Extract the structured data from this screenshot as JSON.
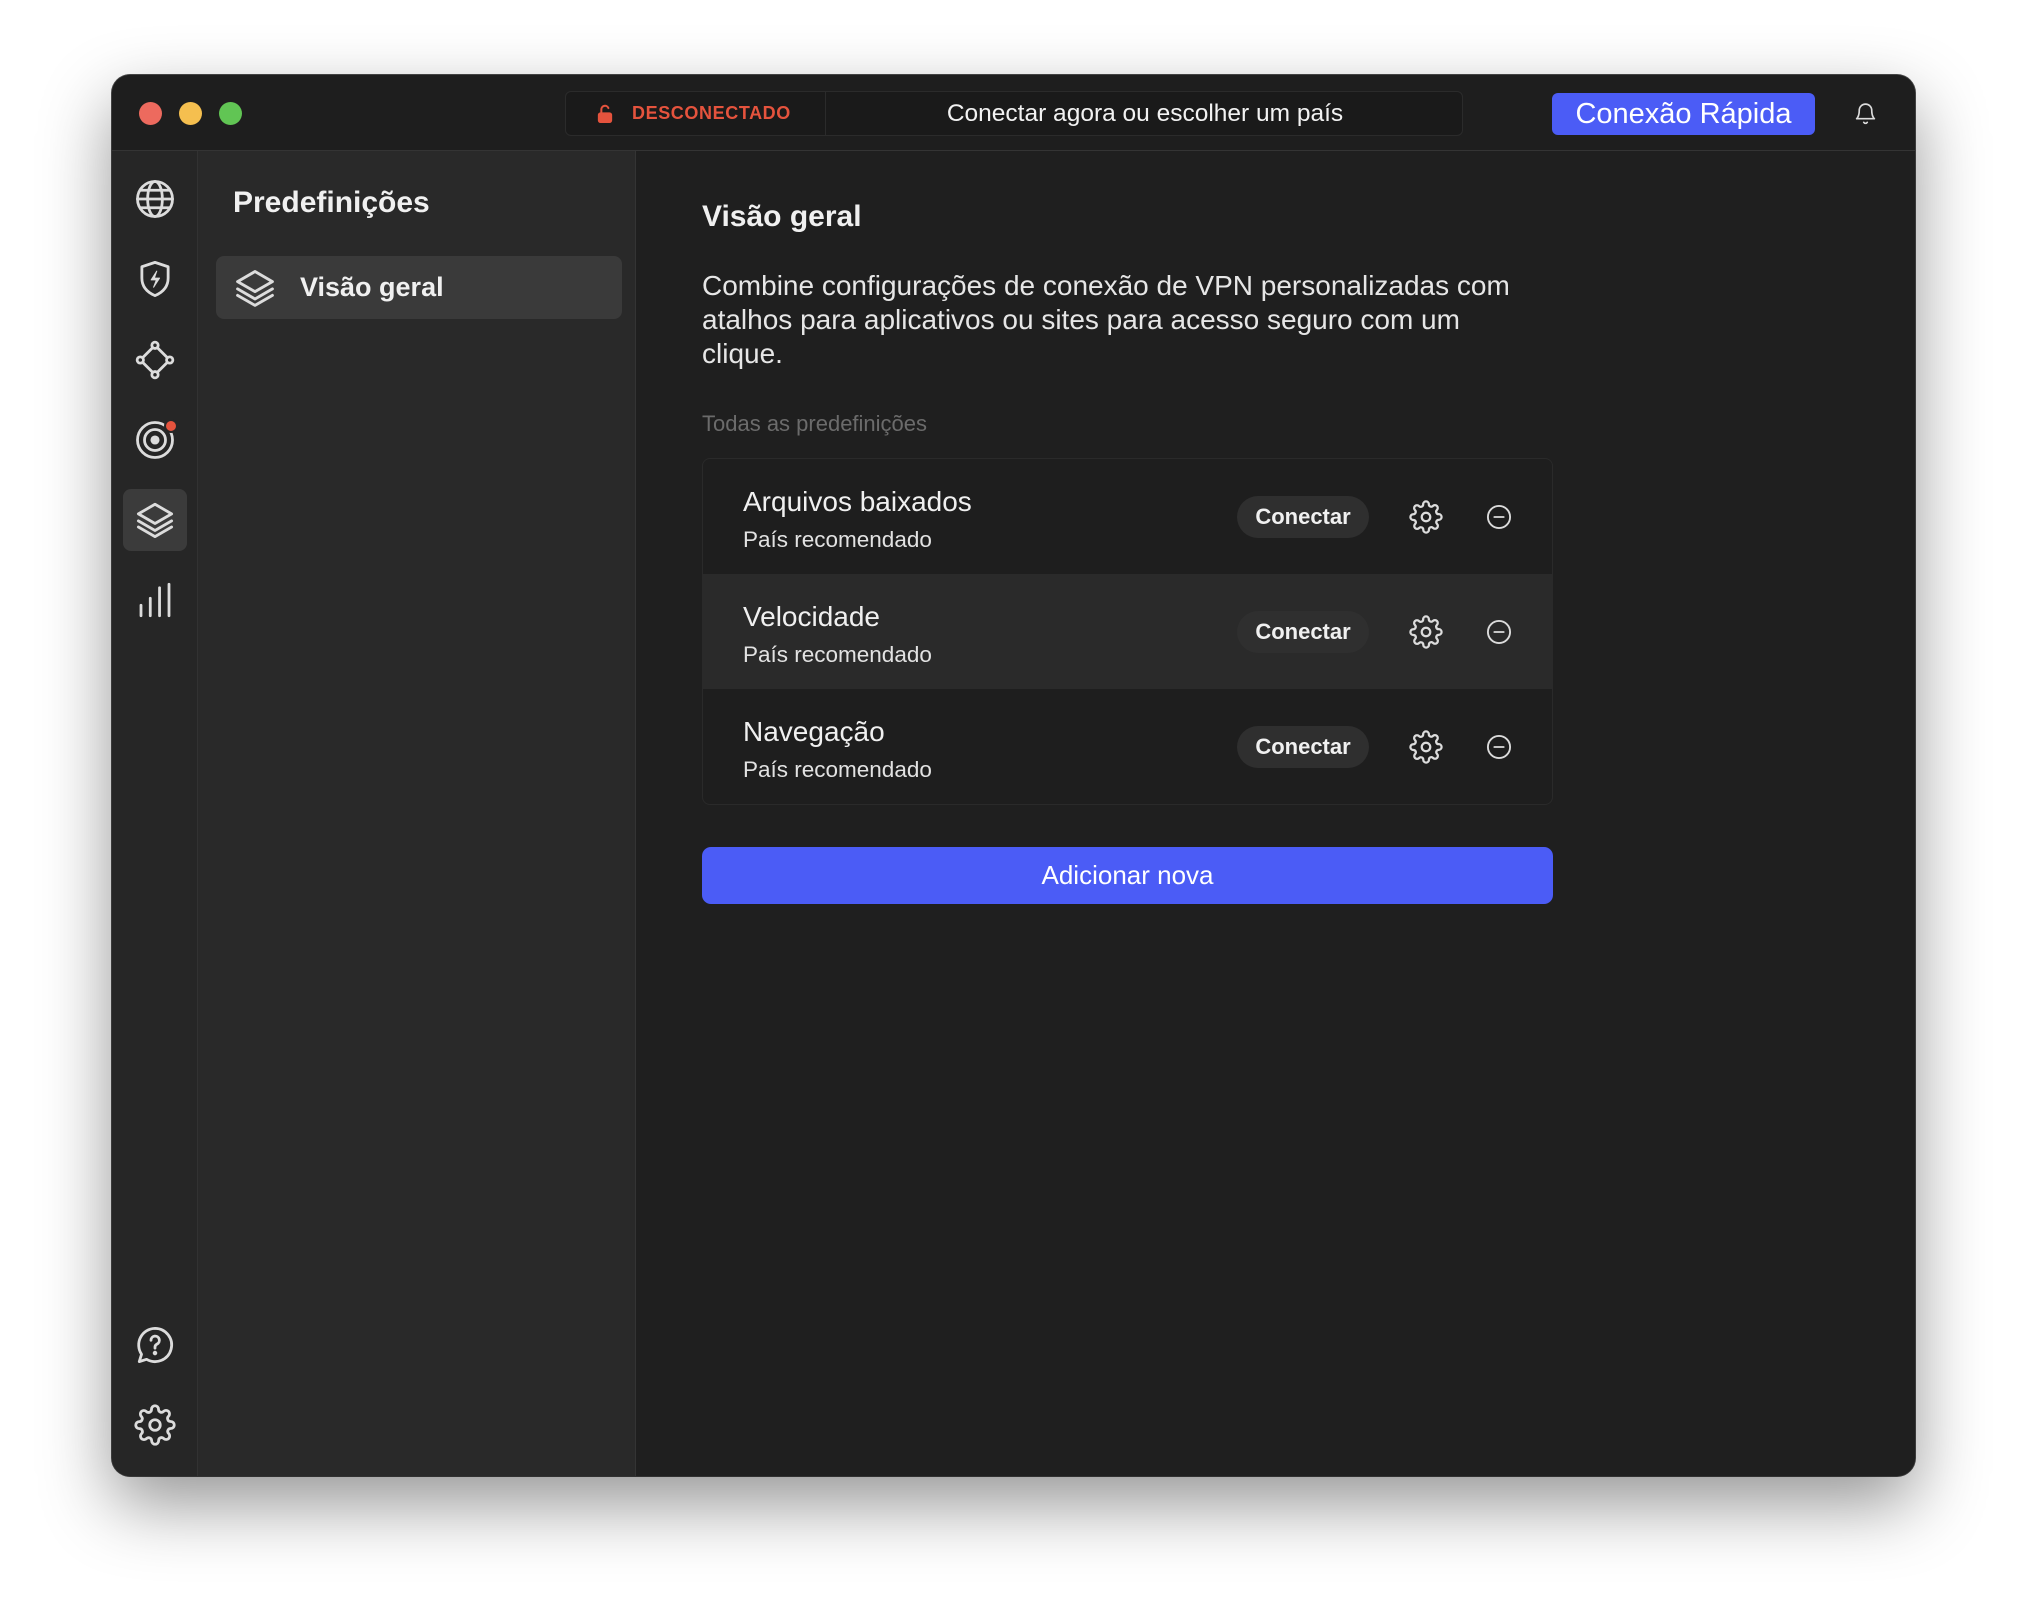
{
  "window": {
    "traffic_lights": {
      "close": "#ed6a5e",
      "minimize": "#f5bf4f",
      "maximize": "#61c554"
    }
  },
  "colors": {
    "accent": "#4b5cf6",
    "disconnected": "#e5533d",
    "badge": "#e5533d"
  },
  "titlebar": {
    "status_icon": "lock-open-icon",
    "status": "DESCONECTADO",
    "prompt": "Conectar agora ou escolher um país",
    "quick_connect": "Conexão Rápida",
    "notifications_icon": "bell-icon"
  },
  "rail": {
    "items": [
      {
        "icon": "globe-icon"
      },
      {
        "icon": "shield-bolt-icon"
      },
      {
        "icon": "meshnet-icon"
      },
      {
        "icon": "target-icon",
        "badge": true
      },
      {
        "icon": "layers-icon",
        "selected": true
      },
      {
        "icon": "bar-chart-icon"
      }
    ],
    "bottom_items": [
      {
        "icon": "help-icon"
      },
      {
        "icon": "gear-icon"
      }
    ]
  },
  "sidebar": {
    "title": "Predefinições",
    "items": [
      {
        "icon": "layers-icon",
        "label": "Visão geral",
        "selected": true
      }
    ]
  },
  "main": {
    "title": "Visão geral",
    "description": "Combine configurações de conexão de VPN personalizadas com atalhos para aplicativos ou sites para acesso seguro com um clique.",
    "section_label": "Todas as predefinições",
    "presets": [
      {
        "name": "Arquivos baixados",
        "subtitle": "País recomendado",
        "connect": "Conectar",
        "highlighted": false
      },
      {
        "name": "Velocidade",
        "subtitle": "País recomendado",
        "connect": "Conectar",
        "highlighted": true
      },
      {
        "name": "Navegação",
        "subtitle": "País recomendado",
        "connect": "Conectar",
        "highlighted": false
      }
    ],
    "add_button": "Adicionar nova"
  }
}
